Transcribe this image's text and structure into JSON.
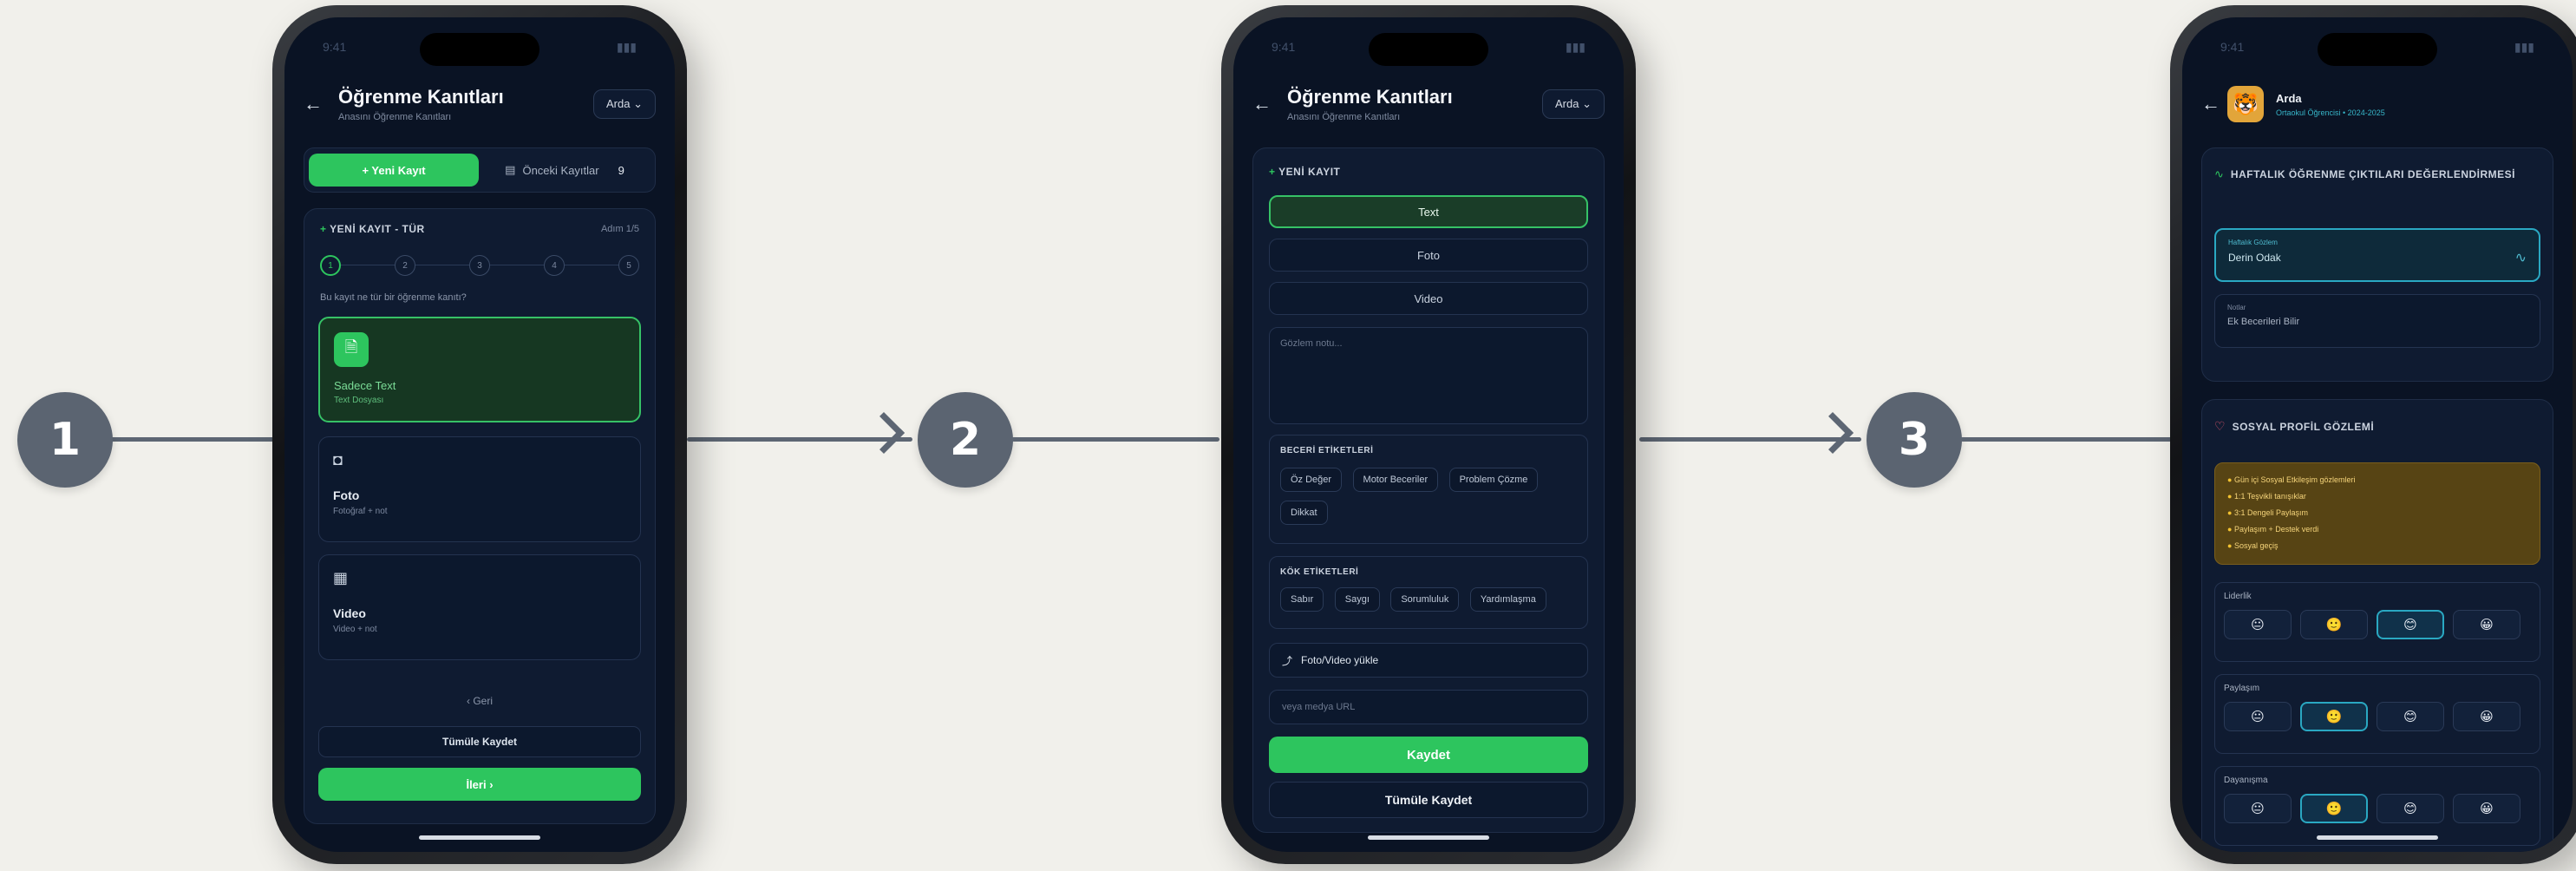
{
  "steps": [
    "1",
    "2",
    "3"
  ],
  "colors": {
    "accent": "#2dc55e",
    "background": "#0a1324",
    "warning": "#f2c230"
  },
  "phone1": {
    "title": "Öğrenme Kanıtları",
    "subtitle": "Anasını Öğrenme Kanıtları",
    "user": "Arda",
    "tab_new": "+ Yeni Kayıt",
    "tab_records": "Önceki Kayıtlar",
    "tab_records_count": "9",
    "wizard_title": "YENİ KAYIT - TÜR",
    "wizard_step_count": "Adım 1/5",
    "wizard_steps": [
      "1",
      "2",
      "3",
      "4",
      "5"
    ],
    "question": "Bu kayıt ne tür bir öğrenme kanıtı?",
    "options": [
      {
        "icon": "text-icon",
        "label": "Sadece Text",
        "sub": "Text Dosyası"
      },
      {
        "icon": "camera-icon",
        "label": "Foto",
        "sub": "Fotoğraf + not"
      },
      {
        "icon": "film-icon",
        "label": "Video",
        "sub": "Video + not"
      }
    ],
    "back_label": "‹  Geri",
    "quick_save": "Tümüle Kaydet",
    "next_label": "İleri  ›"
  },
  "phone2": {
    "title": "Öğrenme Kanıtları",
    "subtitle": "Anasını Öğrenme Kanıtları",
    "user": "Arda",
    "section_title": "YENİ KAYIT",
    "types": [
      "Text",
      "Foto",
      "Video"
    ],
    "note_placeholder": "Gözlem notu...",
    "skills_label": "BECERİ ETİKETLERİ",
    "skills": [
      "Öz Değer",
      "Motor Beceriler",
      "Problem Çözme",
      "Dikkat"
    ],
    "values_label": "KÖK ETİKETLERİ",
    "values": [
      "Sabır",
      "Saygı",
      "Sorumluluk",
      "Yardımlaşma"
    ],
    "upload_label": "Foto/Video yükle",
    "url_placeholder": "veya medya URL",
    "save_button": "Kaydet",
    "quick_save": "Tümüle Kaydet"
  },
  "phone3": {
    "user_name": "Arda",
    "user_meta": "Ortaokul Öğrencisi • 2024-2025",
    "weekly_title": "HAFTALIK ÖĞRENME ÇIKTILARI DEĞERLENDİRMESİ",
    "field1_label": "Haftalık Gözlem",
    "field1_value": "Derin Odak",
    "field2_label": "Notlar",
    "field2_value": "Ek Becerileri Bilir",
    "social_title": "SOSYAL PROFİL GÖZLEMİ",
    "notes": [
      "Gün içi Sosyal Etkileşim gözlemleri",
      "1:1 Teşvikli tanışıklar",
      "3:1 Dengeli Paylaşım",
      "Paylaşım + Destek verdi",
      "Sosyal geçiş"
    ],
    "ratings": [
      {
        "label": "Liderlik",
        "selected": 2,
        "faces": [
          "😐",
          "🙂",
          "😊",
          "😀"
        ]
      },
      {
        "label": "Paylaşım",
        "selected": 1,
        "faces": [
          "😐",
          "🙂",
          "😊",
          "😀"
        ]
      },
      {
        "label": "Dayanışma",
        "selected": 1,
        "faces": [
          "😐",
          "🙂",
          "😊",
          "😀"
        ]
      }
    ]
  }
}
